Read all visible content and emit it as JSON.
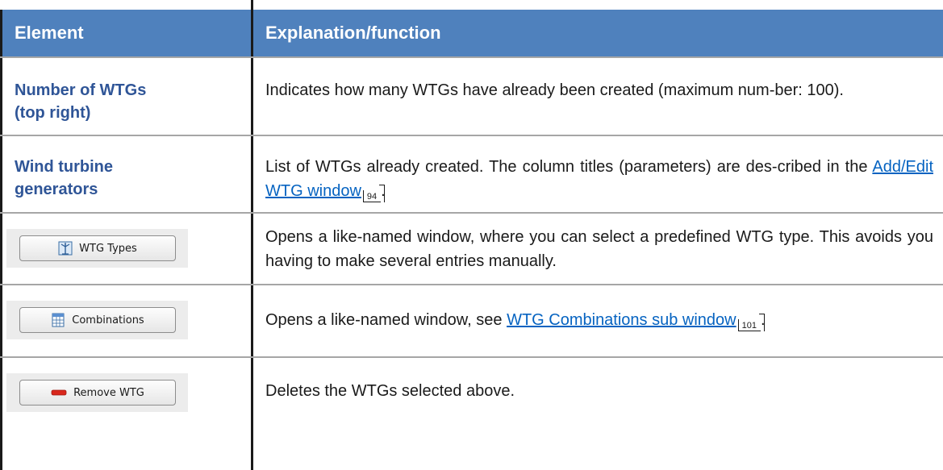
{
  "header": {
    "col_element": "Element",
    "col_explanation": "Explanation/function"
  },
  "rows": [
    {
      "element_line1": "Number of WTGs",
      "element_line2": "(top right)",
      "explanation": "Indicates how many WTGs have already been created (maximum num-ber: 100)."
    },
    {
      "element_line1": "Wind turbine",
      "element_line2": "generators",
      "explanation_before": "List of WTGs already created. The column titles (parameters) are des-cribed in the ",
      "link": "Add/Edit WTG window",
      "page_ref": "94",
      "explanation_after": "."
    },
    {
      "button_label": "WTG Types",
      "button_icon": "wtg-types-icon",
      "explanation": "Opens a like-named window, where you can select a predefined WTG type. This avoids you having to make several entries manually."
    },
    {
      "button_label": "Combinations",
      "button_icon": "combinations-grid-icon",
      "explanation_before": "Opens a like-named window, see ",
      "link": "WTG Combinations sub window",
      "page_ref": "101",
      "explanation_after": "."
    },
    {
      "button_label": "Remove WTG",
      "button_icon": "remove-minus-icon",
      "explanation": "Deletes the WTGs selected above."
    }
  ],
  "colors": {
    "header_bg": "#4f81bd",
    "element_text": "#2f5597",
    "link": "#0563c1",
    "remove_icon": "#d9271c"
  }
}
